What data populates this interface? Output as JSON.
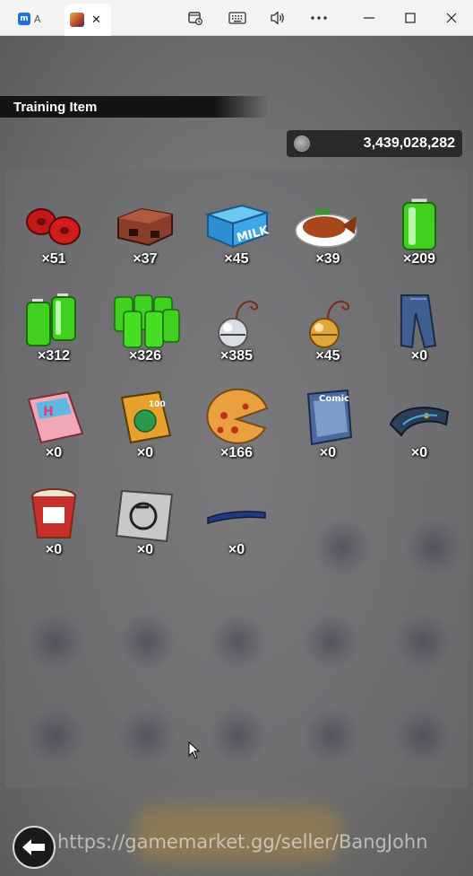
{
  "window": {
    "tabs": [
      {
        "label": "A",
        "active": false
      },
      {
        "label": "",
        "active": true
      }
    ],
    "tab_close": "✕",
    "toolbar_icons": [
      "screenshot-icon",
      "keyboard-icon",
      "volume-icon",
      "more-icon"
    ],
    "controls": [
      "minimize-icon",
      "maximize-icon",
      "close-icon"
    ]
  },
  "screen": {
    "section_title": "Training Item",
    "currency_amount": "3,439,028,282"
  },
  "items": [
    {
      "name": "red-weights",
      "count": "×51"
    },
    {
      "name": "brick",
      "count": "×37"
    },
    {
      "name": "milk",
      "count": "×45",
      "label": "MILK"
    },
    {
      "name": "grilled-fish",
      "count": "×39"
    },
    {
      "name": "battery-single",
      "count": "×209"
    },
    {
      "name": "battery-double",
      "count": "×312"
    },
    {
      "name": "battery-quad",
      "count": "×326"
    },
    {
      "name": "silver-bell",
      "count": "×385"
    },
    {
      "name": "gold-bell",
      "count": "×45"
    },
    {
      "name": "jeans",
      "count": "×0"
    },
    {
      "name": "magazine",
      "count": "×0"
    },
    {
      "name": "board-game",
      "count": "×0"
    },
    {
      "name": "pizza",
      "count": "×166"
    },
    {
      "name": "comic-book",
      "count": "×0",
      "label": "Comic"
    },
    {
      "name": "shoe-insole",
      "count": "×0"
    },
    {
      "name": "cup-noodle",
      "count": "×0"
    },
    {
      "name": "emblem-card",
      "count": "×0"
    },
    {
      "name": "blue-strip",
      "count": "×0"
    }
  ],
  "footer": {
    "watermark": "https://gamemarket.gg/seller/BangJohn"
  },
  "colors": {
    "panel": "#6e6e73",
    "header_bg": "#141414",
    "accent_battery": "#3fd11e"
  }
}
